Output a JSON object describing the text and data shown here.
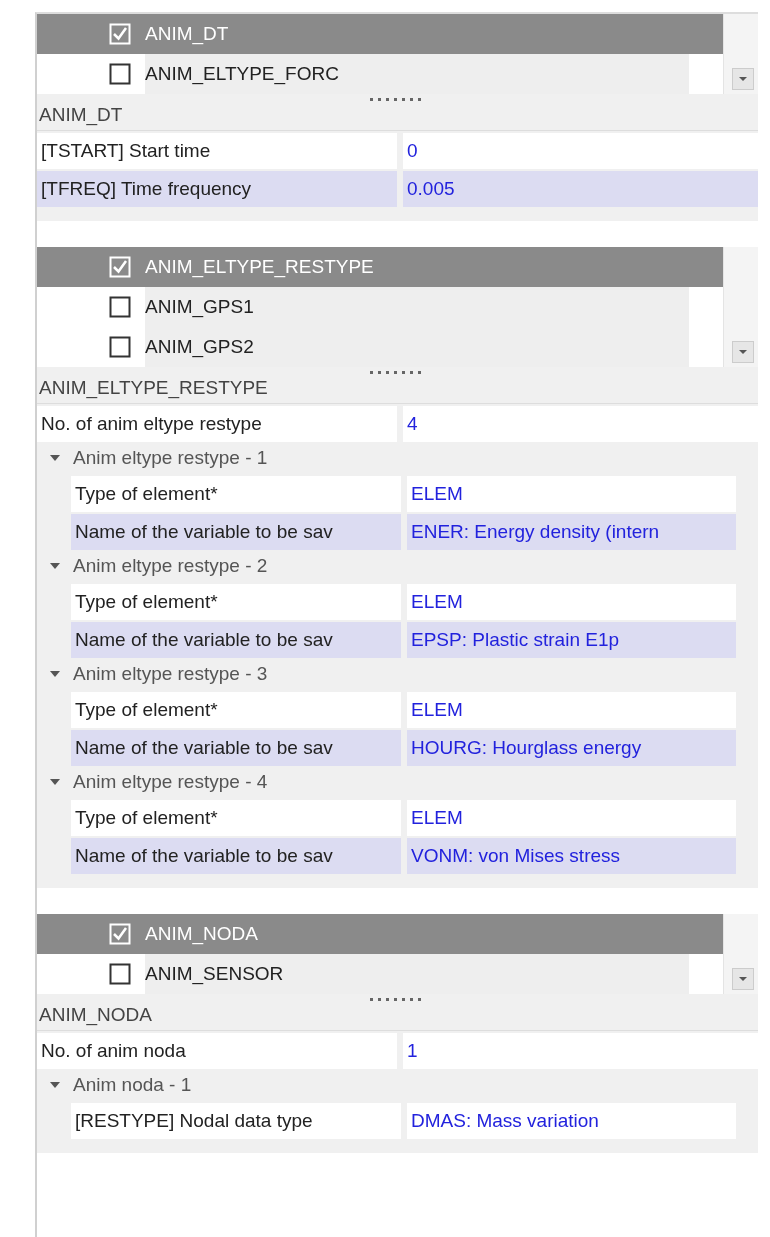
{
  "panels": [
    {
      "items": [
        {
          "label": "ANIM_DT",
          "checked": true,
          "selected": true
        },
        {
          "label": "ANIM_ELTYPE_FORC",
          "checked": false,
          "selected": false
        }
      ],
      "section_title": "ANIM_DT",
      "rows": [
        {
          "kind": "field",
          "label": "[TSTART] Start time",
          "value": "0"
        },
        {
          "kind": "field",
          "label": "[TFREQ] Time frequency",
          "value": "0.005"
        }
      ]
    },
    {
      "items": [
        {
          "label": "ANIM_ELTYPE_RESTYPE",
          "checked": true,
          "selected": true
        },
        {
          "label": "ANIM_GPS1",
          "checked": false,
          "selected": false
        },
        {
          "label": "ANIM_GPS2",
          "checked": false,
          "selected": false
        }
      ],
      "section_title": "ANIM_ELTYPE_RESTYPE",
      "rows": [
        {
          "kind": "field",
          "label": "No. of anim eltype restype",
          "value": "4"
        },
        {
          "kind": "group",
          "title": "Anim eltype restype - 1",
          "expanded": true,
          "rows": [
            {
              "label": "Type of element*",
              "value": "ELEM"
            },
            {
              "label": "Name of the variable to be sav",
              "value": "ENER: Energy density (intern"
            }
          ]
        },
        {
          "kind": "group",
          "title": "Anim eltype restype - 2",
          "expanded": true,
          "rows": [
            {
              "label": "Type of element*",
              "value": "ELEM"
            },
            {
              "label": "Name of the variable to be sav",
              "value": "EPSP: Plastic strain E1p"
            }
          ]
        },
        {
          "kind": "group",
          "title": "Anim eltype restype - 3",
          "expanded": true,
          "rows": [
            {
              "label": "Type of element*",
              "value": "ELEM"
            },
            {
              "label": "Name of the variable to be sav",
              "value": "HOURG: Hourglass energy"
            }
          ]
        },
        {
          "kind": "group",
          "title": "Anim eltype restype - 4",
          "expanded": true,
          "rows": [
            {
              "label": "Type of element*",
              "value": "ELEM"
            },
            {
              "label": "Name of the variable to be sav",
              "value": "VONM: von Mises stress"
            }
          ]
        }
      ]
    },
    {
      "items": [
        {
          "label": "ANIM_NODA",
          "checked": true,
          "selected": true
        },
        {
          "label": "ANIM_SENSOR",
          "checked": false,
          "selected": false
        }
      ],
      "section_title": "ANIM_NODA",
      "rows": [
        {
          "kind": "field",
          "label": "No. of anim noda",
          "value": "1"
        },
        {
          "kind": "group",
          "title": "Anim noda - 1",
          "expanded": true,
          "rows": [
            {
              "label": "[RESTYPE] Nodal data type",
              "value": "DMAS: Mass variation"
            }
          ]
        }
      ]
    }
  ]
}
